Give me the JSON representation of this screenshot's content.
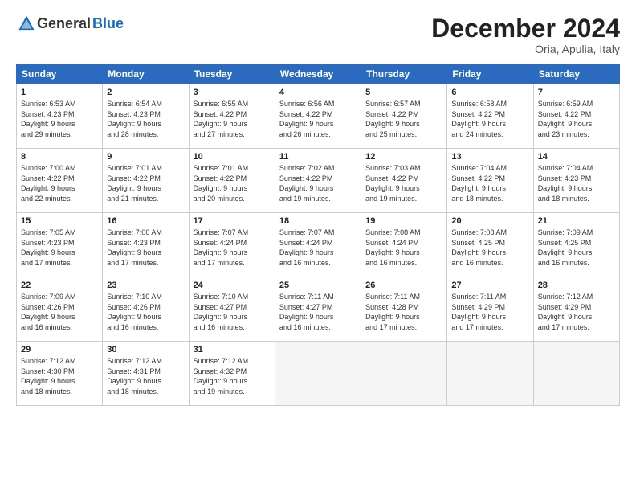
{
  "header": {
    "logo_general": "General",
    "logo_blue": "Blue",
    "month_title": "December 2024",
    "location": "Oria, Apulia, Italy"
  },
  "weekdays": [
    "Sunday",
    "Monday",
    "Tuesday",
    "Wednesday",
    "Thursday",
    "Friday",
    "Saturday"
  ],
  "weeks": [
    [
      {
        "day": "1",
        "info": "Sunrise: 6:53 AM\nSunset: 4:23 PM\nDaylight: 9 hours\nand 29 minutes."
      },
      {
        "day": "2",
        "info": "Sunrise: 6:54 AM\nSunset: 4:23 PM\nDaylight: 9 hours\nand 28 minutes."
      },
      {
        "day": "3",
        "info": "Sunrise: 6:55 AM\nSunset: 4:22 PM\nDaylight: 9 hours\nand 27 minutes."
      },
      {
        "day": "4",
        "info": "Sunrise: 6:56 AM\nSunset: 4:22 PM\nDaylight: 9 hours\nand 26 minutes."
      },
      {
        "day": "5",
        "info": "Sunrise: 6:57 AM\nSunset: 4:22 PM\nDaylight: 9 hours\nand 25 minutes."
      },
      {
        "day": "6",
        "info": "Sunrise: 6:58 AM\nSunset: 4:22 PM\nDaylight: 9 hours\nand 24 minutes."
      },
      {
        "day": "7",
        "info": "Sunrise: 6:59 AM\nSunset: 4:22 PM\nDaylight: 9 hours\nand 23 minutes."
      }
    ],
    [
      {
        "day": "8",
        "info": "Sunrise: 7:00 AM\nSunset: 4:22 PM\nDaylight: 9 hours\nand 22 minutes."
      },
      {
        "day": "9",
        "info": "Sunrise: 7:01 AM\nSunset: 4:22 PM\nDaylight: 9 hours\nand 21 minutes."
      },
      {
        "day": "10",
        "info": "Sunrise: 7:01 AM\nSunset: 4:22 PM\nDaylight: 9 hours\nand 20 minutes."
      },
      {
        "day": "11",
        "info": "Sunrise: 7:02 AM\nSunset: 4:22 PM\nDaylight: 9 hours\nand 19 minutes."
      },
      {
        "day": "12",
        "info": "Sunrise: 7:03 AM\nSunset: 4:22 PM\nDaylight: 9 hours\nand 19 minutes."
      },
      {
        "day": "13",
        "info": "Sunrise: 7:04 AM\nSunset: 4:22 PM\nDaylight: 9 hours\nand 18 minutes."
      },
      {
        "day": "14",
        "info": "Sunrise: 7:04 AM\nSunset: 4:23 PM\nDaylight: 9 hours\nand 18 minutes."
      }
    ],
    [
      {
        "day": "15",
        "info": "Sunrise: 7:05 AM\nSunset: 4:23 PM\nDaylight: 9 hours\nand 17 minutes."
      },
      {
        "day": "16",
        "info": "Sunrise: 7:06 AM\nSunset: 4:23 PM\nDaylight: 9 hours\nand 17 minutes."
      },
      {
        "day": "17",
        "info": "Sunrise: 7:07 AM\nSunset: 4:24 PM\nDaylight: 9 hours\nand 17 minutes."
      },
      {
        "day": "18",
        "info": "Sunrise: 7:07 AM\nSunset: 4:24 PM\nDaylight: 9 hours\nand 16 minutes."
      },
      {
        "day": "19",
        "info": "Sunrise: 7:08 AM\nSunset: 4:24 PM\nDaylight: 9 hours\nand 16 minutes."
      },
      {
        "day": "20",
        "info": "Sunrise: 7:08 AM\nSunset: 4:25 PM\nDaylight: 9 hours\nand 16 minutes."
      },
      {
        "day": "21",
        "info": "Sunrise: 7:09 AM\nSunset: 4:25 PM\nDaylight: 9 hours\nand 16 minutes."
      }
    ],
    [
      {
        "day": "22",
        "info": "Sunrise: 7:09 AM\nSunset: 4:26 PM\nDaylight: 9 hours\nand 16 minutes."
      },
      {
        "day": "23",
        "info": "Sunrise: 7:10 AM\nSunset: 4:26 PM\nDaylight: 9 hours\nand 16 minutes."
      },
      {
        "day": "24",
        "info": "Sunrise: 7:10 AM\nSunset: 4:27 PM\nDaylight: 9 hours\nand 16 minutes."
      },
      {
        "day": "25",
        "info": "Sunrise: 7:11 AM\nSunset: 4:27 PM\nDaylight: 9 hours\nand 16 minutes."
      },
      {
        "day": "26",
        "info": "Sunrise: 7:11 AM\nSunset: 4:28 PM\nDaylight: 9 hours\nand 17 minutes."
      },
      {
        "day": "27",
        "info": "Sunrise: 7:11 AM\nSunset: 4:29 PM\nDaylight: 9 hours\nand 17 minutes."
      },
      {
        "day": "28",
        "info": "Sunrise: 7:12 AM\nSunset: 4:29 PM\nDaylight: 9 hours\nand 17 minutes."
      }
    ],
    [
      {
        "day": "29",
        "info": "Sunrise: 7:12 AM\nSunset: 4:30 PM\nDaylight: 9 hours\nand 18 minutes."
      },
      {
        "day": "30",
        "info": "Sunrise: 7:12 AM\nSunset: 4:31 PM\nDaylight: 9 hours\nand 18 minutes."
      },
      {
        "day": "31",
        "info": "Sunrise: 7:12 AM\nSunset: 4:32 PM\nDaylight: 9 hours\nand 19 minutes."
      },
      {
        "day": "",
        "info": ""
      },
      {
        "day": "",
        "info": ""
      },
      {
        "day": "",
        "info": ""
      },
      {
        "day": "",
        "info": ""
      }
    ]
  ]
}
